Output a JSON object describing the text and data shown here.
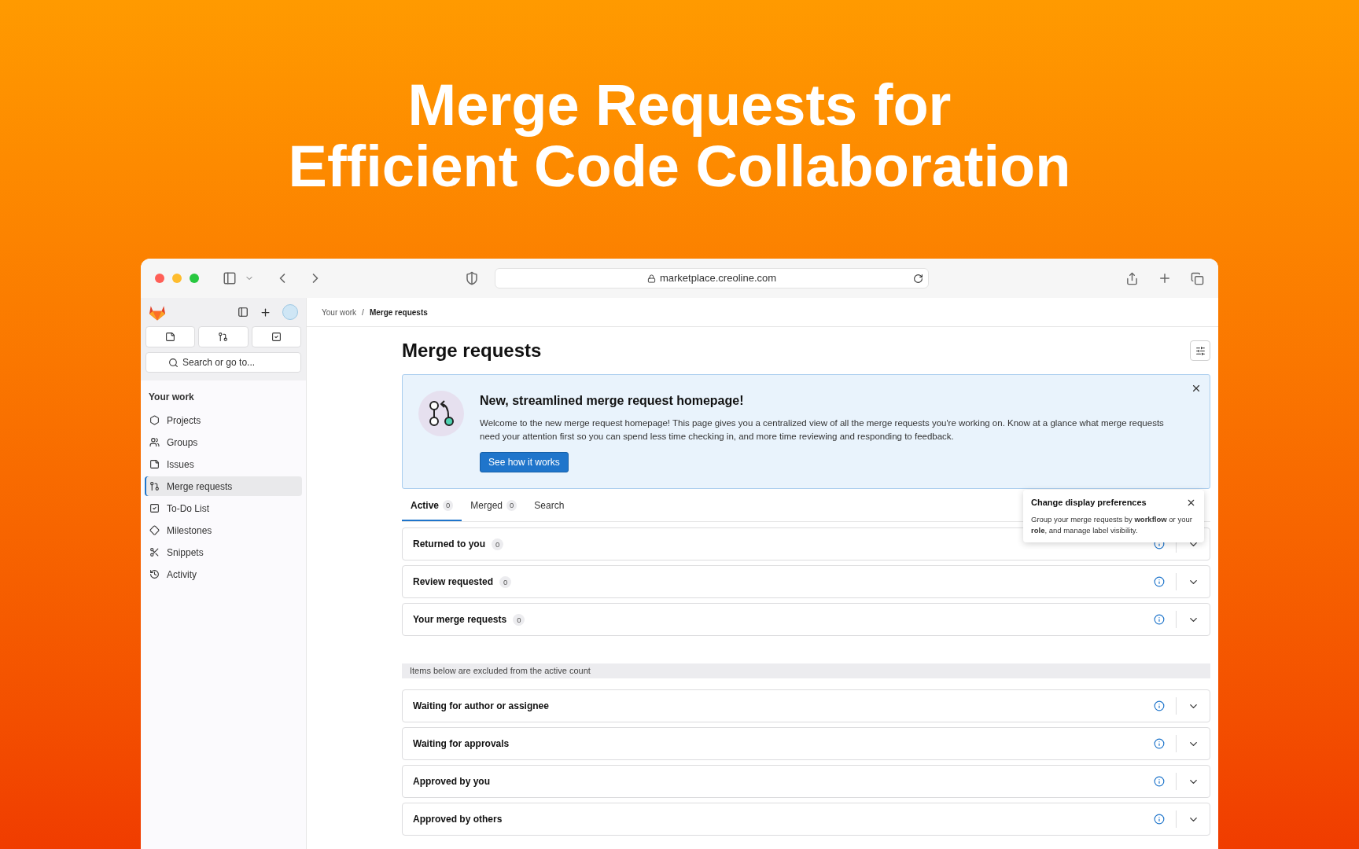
{
  "hero": {
    "lines": [
      "Merge Requests for",
      "Efficient Code Collaboration"
    ]
  },
  "browser": {
    "url": "marketplace.creoline.com"
  },
  "sidebar": {
    "search_placeholder": "Search or go to...",
    "section_title": "Your work",
    "items": [
      {
        "label": "Projects",
        "selected": false
      },
      {
        "label": "Groups",
        "selected": false
      },
      {
        "label": "Issues",
        "selected": false
      },
      {
        "label": "Merge requests",
        "selected": true
      },
      {
        "label": "To-Do List",
        "selected": false
      },
      {
        "label": "Milestones",
        "selected": false
      },
      {
        "label": "Snippets",
        "selected": false
      },
      {
        "label": "Activity",
        "selected": false
      }
    ]
  },
  "breadcrumb": {
    "items": [
      "Your work",
      "Merge requests"
    ],
    "separator": "/"
  },
  "page_title": "Merge requests",
  "banner": {
    "title": "New, streamlined merge request homepage!",
    "body": "Welcome to the new merge request homepage! This page gives you a centralized view of all the merge requests you're working on. Know at a glance what merge requests need your attention first so you can spend less time checking in, and more time reviewing and responding to feedback.",
    "button": "See how it works"
  },
  "tabs": [
    {
      "label": "Active",
      "count": "0",
      "selected": true
    },
    {
      "label": "Merged",
      "count": "0",
      "selected": false
    },
    {
      "label": "Search",
      "selected": false
    }
  ],
  "tooltip": {
    "title": "Change display preferences",
    "body": "Group your merge requests by **workflow** or your **role**, and manage label visibility."
  },
  "sections": [
    {
      "kind": "group",
      "label": "Returned to you",
      "count": "0"
    },
    {
      "kind": "group",
      "label": "Review requested",
      "count": "0"
    },
    {
      "kind": "group",
      "label": "Your merge requests",
      "count": "0"
    },
    {
      "kind": "note",
      "label": "Items below are excluded from the active count"
    },
    {
      "kind": "group",
      "label": "Waiting for author or assignee"
    },
    {
      "kind": "group",
      "label": "Waiting for approvals"
    },
    {
      "kind": "group",
      "label": "Approved by you"
    },
    {
      "kind": "group",
      "label": "Approved by others"
    }
  ]
}
